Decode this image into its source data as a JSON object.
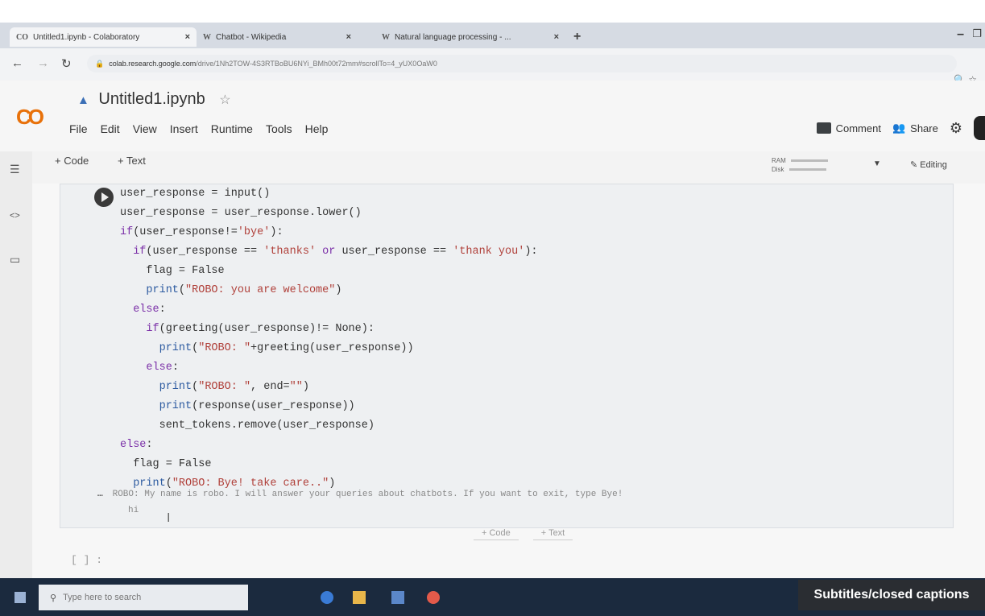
{
  "tabs": [
    {
      "favicon": "CO",
      "title": "Untitled1.ipynb - Colaboratory",
      "close": "×"
    },
    {
      "favicon": "W",
      "title": "Chatbot - Wikipedia",
      "close": "×"
    },
    {
      "favicon": "W",
      "title": "Natural language processing - ...",
      "close": "×"
    }
  ],
  "new_tab": "+",
  "address": {
    "host": "colab.research.google.com",
    "path": "/drive/1Nh2TOW-4S3RTBoBU6NYi_BMh00t72mm#scrollTo=4_yUX0OaW0"
  },
  "notebook": {
    "title": "Untitled1.ipynb",
    "menu": [
      "File",
      "Edit",
      "View",
      "Insert",
      "Runtime",
      "Tools",
      "Help"
    ],
    "comment_label": "Comment",
    "share_label": "Share",
    "add_code": "+ Code",
    "add_text": "+ Text",
    "ram_label": "RAM",
    "disk_label": "Disk",
    "editing_label": "Editing"
  },
  "output": {
    "line1": "ROBO: My name is robo. I will answer your queries about chatbots. If you want to exit, type Bye!",
    "line2": "hi"
  },
  "next_cell": "[ ] :",
  "taskbar": {
    "search_placeholder": "Type here to search"
  },
  "captions_label": "Subtitles/closed captions",
  "icons": [
    "back-arrow-icon",
    "forward-arrow-icon",
    "reload-icon",
    "lock-icon",
    "drive-icon",
    "star-icon",
    "comment-icon",
    "share-icon",
    "gear-icon",
    "run-icon",
    "windows-start-icon",
    "search-icon"
  ]
}
